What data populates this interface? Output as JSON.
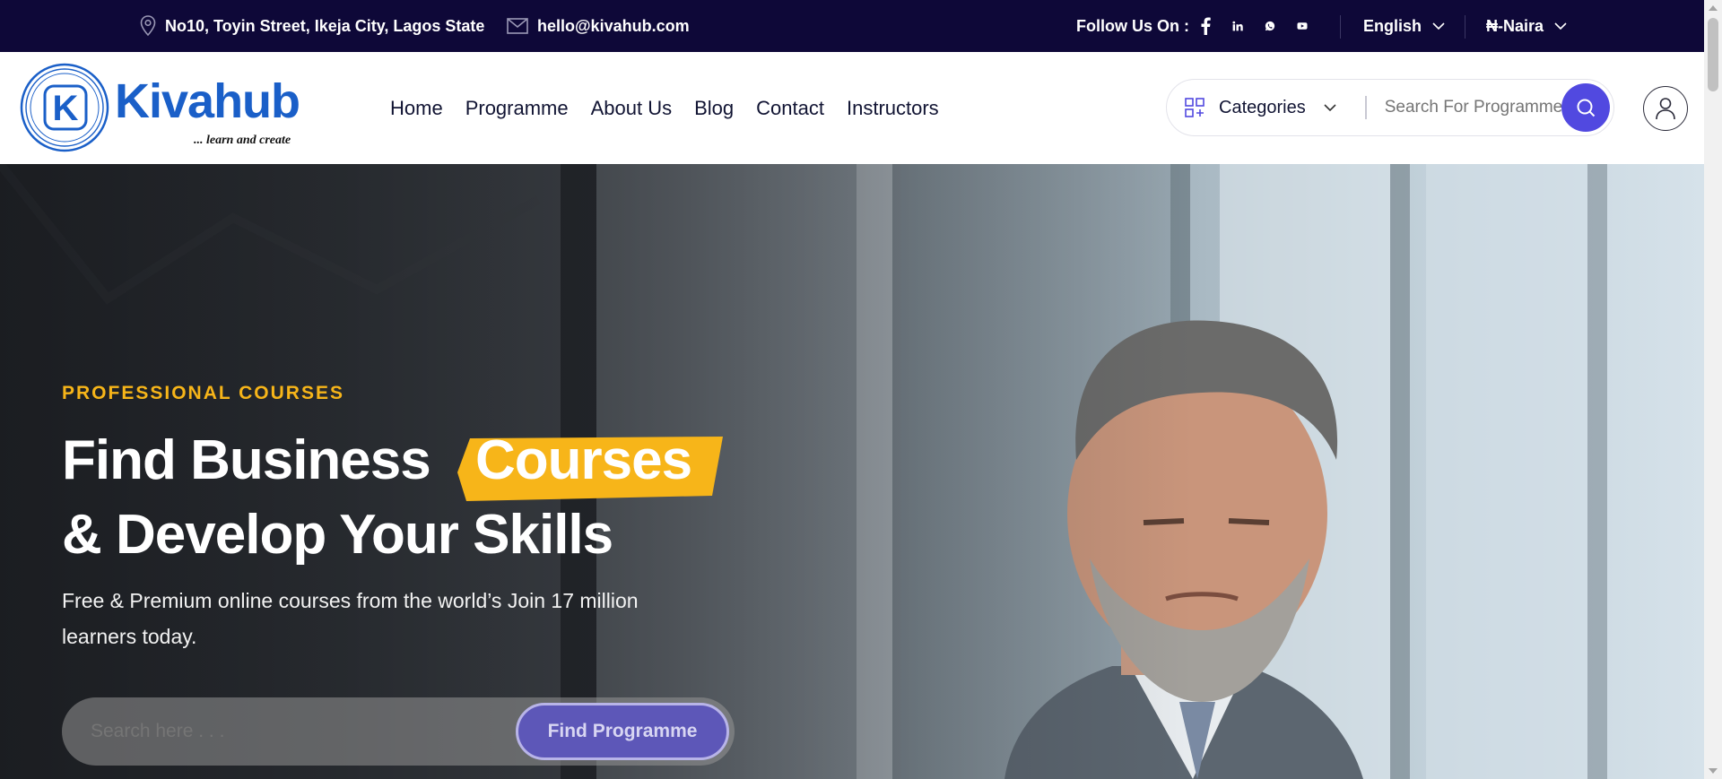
{
  "topbar": {
    "address": "No10, Toyin Street, Ikeja City, Lagos State",
    "email": "hello@kivahub.com",
    "follow_label": "Follow Us On :",
    "social": [
      "facebook-icon",
      "linkedin-icon",
      "whatsapp-icon",
      "youtube-icon"
    ],
    "language": "English",
    "currency": "₦-Naira"
  },
  "header": {
    "logo": {
      "word": "Kivahub",
      "tagline": "... learn and create",
      "mark_letter": "K"
    },
    "nav": [
      "Home",
      "Programme",
      "About Us",
      "Blog",
      "Contact",
      "Instructors"
    ],
    "categories_label": "Categories",
    "search_placeholder": "Search For Programme"
  },
  "hero": {
    "eyebrow": "PROFESSIONAL COURSES",
    "title_line1": "Find Business",
    "title_highlight": "Courses",
    "title_line2": "& Develop Your Skills",
    "subtitle": "Free & Premium online courses from the world’s Join 17 million learners today.",
    "search_placeholder": "Search here . . .",
    "search_button": "Find Programme"
  },
  "colors": {
    "topbar_bg": "#0e0838",
    "brand_blue": "#1a5fc8",
    "accent_purple": "#5149e0",
    "highlight_yellow": "#f7b519"
  }
}
